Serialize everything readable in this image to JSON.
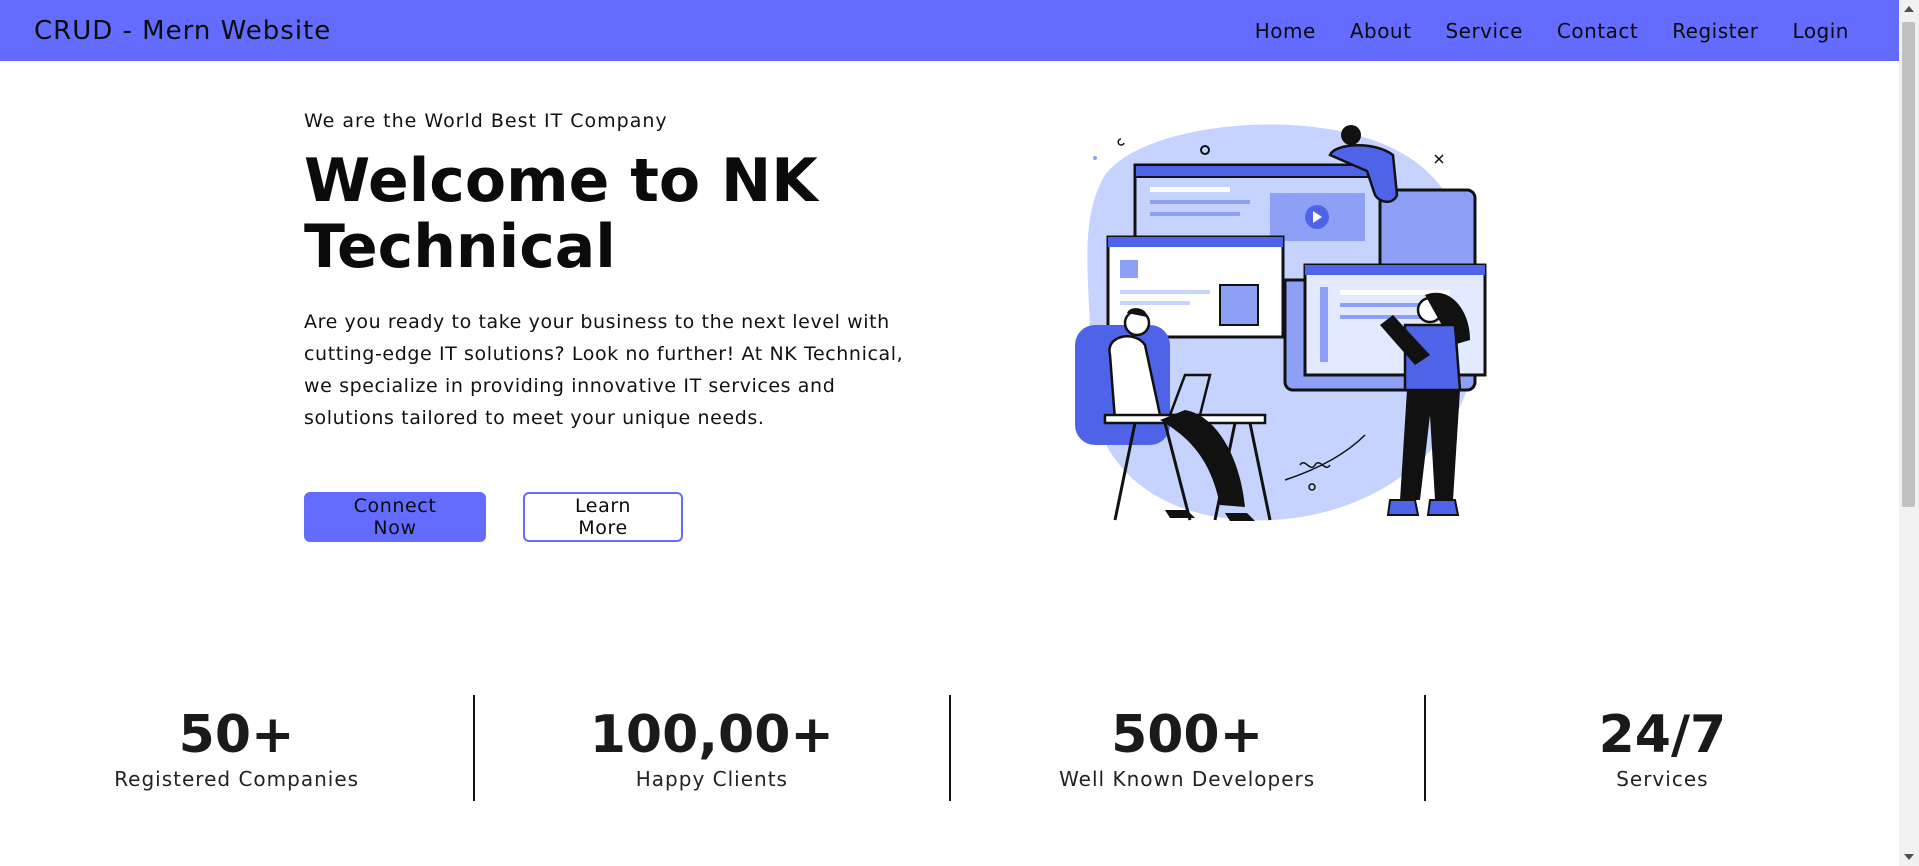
{
  "navbar": {
    "brand": "CRUD - Mern Website",
    "links": [
      "Home",
      "About",
      "Service",
      "Contact",
      "Register",
      "Login"
    ]
  },
  "hero": {
    "tagline": "We are the World Best IT Company",
    "title": "Welcome to NK Technical",
    "description": "Are you ready to take your business to the next level with cutting-edge IT solutions? Look no further! At NK Technical, we specialize in providing innovative IT services and solutions tailored to meet your unique needs.",
    "primary_button": "Connect Now",
    "secondary_button": "Learn More",
    "illustration_icon": "team-working-illustration"
  },
  "stats": [
    {
      "value": "50+",
      "label": "Registered Companies"
    },
    {
      "value": "100,00+",
      "label": "Happy Clients"
    },
    {
      "value": "500+",
      "label": "Well Known Developers"
    },
    {
      "value": "24/7",
      "label": "Services"
    }
  ],
  "colors": {
    "accent": "#646cff",
    "illustration_light": "#c7d3ff",
    "illustration_mid": "#8ea0f5",
    "illustration_dark": "#4f63e8"
  }
}
